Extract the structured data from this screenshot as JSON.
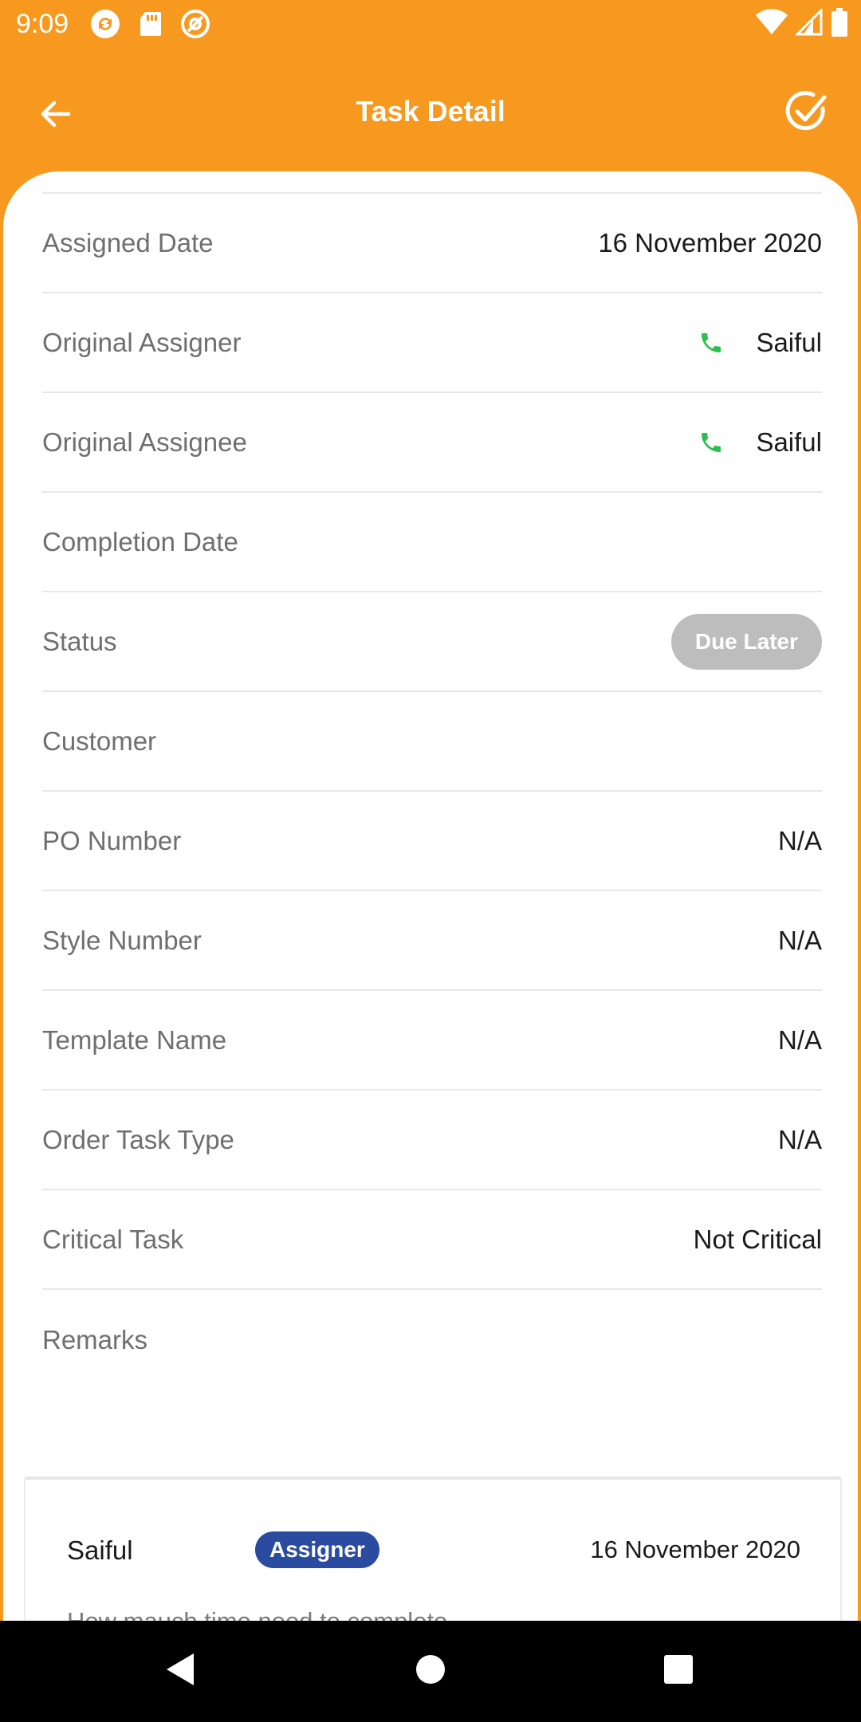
{
  "status_bar": {
    "time": "9:09",
    "left_icons": [
      "sync-icon",
      "sd-card-icon",
      "at-sign-icon"
    ],
    "right_icons": [
      "wifi-icon",
      "signal-icon",
      "battery-icon"
    ]
  },
  "app_bar": {
    "title": "Task Detail",
    "back_icon": "arrow-left-icon",
    "action_icon": "check-circle-icon",
    "background_color": "#F7991F"
  },
  "details": [
    {
      "label": "Assigned Date",
      "value": "16 November 2020"
    },
    {
      "label": "Original Assigner",
      "value": "Saiful",
      "phone_icon": true
    },
    {
      "label": "Original Assignee",
      "value": "Saiful",
      "phone_icon": true
    },
    {
      "label": "Completion Date",
      "value": ""
    },
    {
      "label": "Status",
      "value": "Due Later",
      "badge_color": "#BDBDBD"
    },
    {
      "label": "Customer",
      "value": ""
    },
    {
      "label": "PO Number",
      "value": "N/A"
    },
    {
      "label": "Style Number",
      "value": "N/A"
    },
    {
      "label": "Template Name",
      "value": "N/A"
    },
    {
      "label": "Order Task Type",
      "value": "N/A"
    },
    {
      "label": "Critical Task",
      "value": "Not Critical"
    },
    {
      "label": "Remarks",
      "value": ""
    }
  ],
  "comment": {
    "name": "Saiful",
    "role": "Assigner",
    "role_color": "#2A4BA0",
    "date": "16 November 2020",
    "text": "How mauch time need to complete"
  },
  "colors": {
    "phone_green": "#2DBE4E"
  }
}
